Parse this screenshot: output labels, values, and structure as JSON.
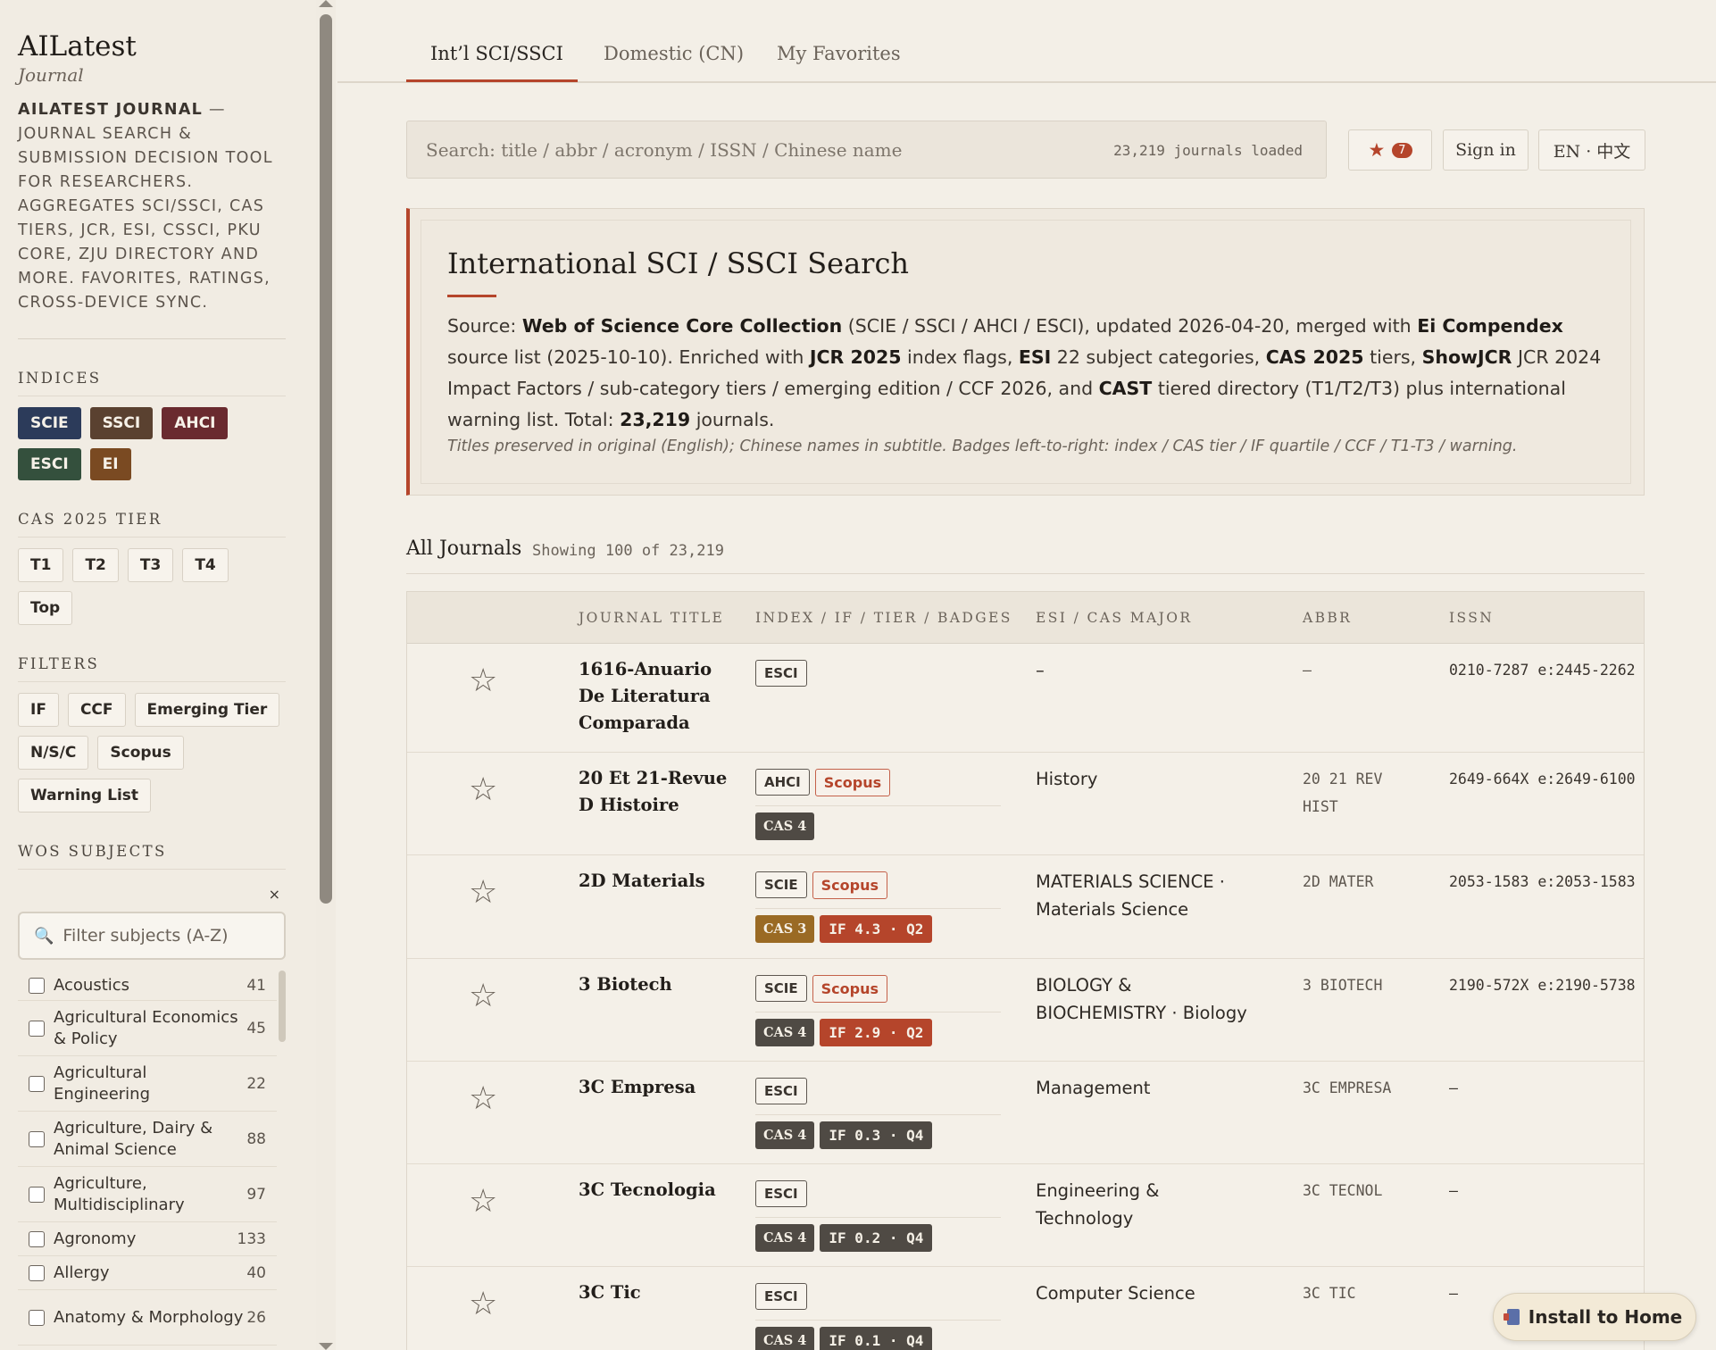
{
  "brand": {
    "title": "AILatest",
    "subtitle": "Journal",
    "desc_strong": "AILATEST JOURNAL",
    "desc_rest": " — JOURNAL SEARCH & SUBMISSION DECISION TOOL FOR RESEARCHERS. AGGREGATES SCI/SSCI, CAS TIERS, JCR, ESI, CSSCI, PKU CORE, ZJU DIRECTORY AND MORE. FAVORITES, RATINGS, CROSS-DEVICE SYNC."
  },
  "sidebar": {
    "indices_heading": "INDICES",
    "indices": [
      {
        "label": "SCIE",
        "color": "#2c3b5a"
      },
      {
        "label": "SSCI",
        "color": "#5a4130"
      },
      {
        "label": "AHCI",
        "color": "#6a2a2f"
      },
      {
        "label": "ESCI",
        "color": "#34503d"
      },
      {
        "label": "EI",
        "color": "#7a4a22"
      }
    ],
    "cas_heading": "CAS 2025 TIER",
    "cas_tiers": [
      "T1",
      "T2",
      "T3",
      "T4",
      "Top"
    ],
    "filters_heading": "FILTERS",
    "filters": [
      "IF",
      "CCF",
      "Emerging Tier",
      "N/S/C",
      "Scopus",
      "Warning List"
    ],
    "subjects_heading": "WOS SUBJECTS",
    "subjects_clear": "×",
    "subjects_placeholder": "Filter subjects (A-Z)",
    "subjects": [
      {
        "name": "Acoustics",
        "count": "41"
      },
      {
        "name": "Agricultural Economics & Policy",
        "count": "45"
      },
      {
        "name": "Agricultural Engineering",
        "count": "22"
      },
      {
        "name": "Agriculture, Dairy & Animal Science",
        "count": "88"
      },
      {
        "name": "Agriculture, Multidisciplinary",
        "count": "97"
      },
      {
        "name": "Agronomy",
        "count": "133"
      },
      {
        "name": "Allergy",
        "count": "40"
      },
      {
        "name": "Anatomy & Morphology",
        "count": "26"
      }
    ]
  },
  "tabs": [
    {
      "label": "Int’l SCI/SSCI",
      "active": true
    },
    {
      "label": "Domestic (CN)",
      "active": false
    },
    {
      "label": "My Favorites",
      "active": false
    }
  ],
  "search": {
    "placeholder": "Search: title / abbr / acronym / ISSN / Chinese name",
    "count": "23,219 journals loaded"
  },
  "header_buttons": {
    "favorites_icon": "★",
    "favorites_count": "7",
    "sign_in": "Sign in",
    "lang": "EN · 中文"
  },
  "info_card": {
    "title": "International SCI / SSCI Search",
    "p1_a": "Source: ",
    "p1_b": "Web of Science Core Collection",
    "p1_c": " (SCIE / SSCI / AHCI / ESCI), updated 2026-04-20, merged with ",
    "p1_d": "Ei Compendex",
    "p1_e": " source list (2025-10-10). Enriched with ",
    "p1_f": "JCR 2025",
    "p1_g": " index flags, ",
    "p1_h": "ESI",
    "p1_i": " 22 subject categories, ",
    "p1_j": "CAS 2025",
    "p1_k": " tiers, ",
    "p1_l": "ShowJCR",
    "p1_m": " JCR 2024 Impact Factors / sub-category tiers / emerging edition / CCF 2026, and ",
    "p1_n": "CAST",
    "p1_o": " tiered directory (T1/T2/T3) plus international warning list. Total: ",
    "p1_p": "23,219",
    "p1_q": " journals.",
    "note": "Titles preserved in original (English); Chinese names in subtitle. Badges left-to-right: index / CAS tier / IF quartile / CCF / T1-T3 / warning."
  },
  "list": {
    "heading": "All Journals",
    "showing": "Showing 100 of 23,219"
  },
  "table": {
    "headers": [
      "JOURNAL TITLE",
      "INDEX / IF / TIER / BADGES",
      "ESI / CAS MAJOR",
      "ABBR",
      "ISSN"
    ],
    "rows": [
      {
        "title": "1616-Anuario De Literatura Comparada",
        "index": "ESCI",
        "scopus": "",
        "cas": "",
        "if": "",
        "esi": "–",
        "abbr": "–",
        "issn": "0210-7287 e:2445-2262"
      },
      {
        "title": "20 Et 21-Revue D Histoire",
        "index": "AHCI",
        "scopus": "Scopus",
        "cas": "CAS 4",
        "if": "",
        "esi": "History",
        "abbr": "20 21 REV HIST",
        "issn": "2649-664X e:2649-6100"
      },
      {
        "title": "2D Materials",
        "index": "SCIE",
        "scopus": "Scopus",
        "cas": "CAS 3",
        "if": "IF 4.3 · Q2",
        "esi": "MATERIALS SCIENCE · Materials Science",
        "abbr": "2D MATER",
        "issn": "2053-1583 e:2053-1583"
      },
      {
        "title": "3 Biotech",
        "index": "SCIE",
        "scopus": "Scopus",
        "cas": "CAS 4",
        "if": "IF 2.9 · Q2",
        "esi": "BIOLOGY & BIOCHEMISTRY · Biology",
        "abbr": "3 BIOTECH",
        "issn": "2190-572X e:2190-5738"
      },
      {
        "title": "3C Empresa",
        "index": "ESCI",
        "scopus": "",
        "cas": "CAS 4",
        "if": "IF 0.3 · Q4",
        "esi": "Management",
        "abbr": "3C EMPRESA",
        "issn": "–"
      },
      {
        "title": "3C Tecnologia",
        "index": "ESCI",
        "scopus": "",
        "cas": "CAS 4",
        "if": "IF 0.2 · Q4",
        "esi": "Engineering & Technology",
        "abbr": "3C TECNOL",
        "issn": "–"
      },
      {
        "title": "3C Tic",
        "index": "ESCI",
        "scopus": "",
        "cas": "CAS 4",
        "if": "IF 0.1 · Q4",
        "esi": "Computer Science",
        "abbr": "3C TIC",
        "issn": "–"
      }
    ],
    "star_icon": "☆"
  },
  "install": {
    "label": "Install to Home"
  },
  "colors": {
    "accent": "#b5452b",
    "cas3": "#9a6a24",
    "cas4": "#4f4a44",
    "if_q2": "#b5452b",
    "if_q4": "#4f4a44"
  }
}
